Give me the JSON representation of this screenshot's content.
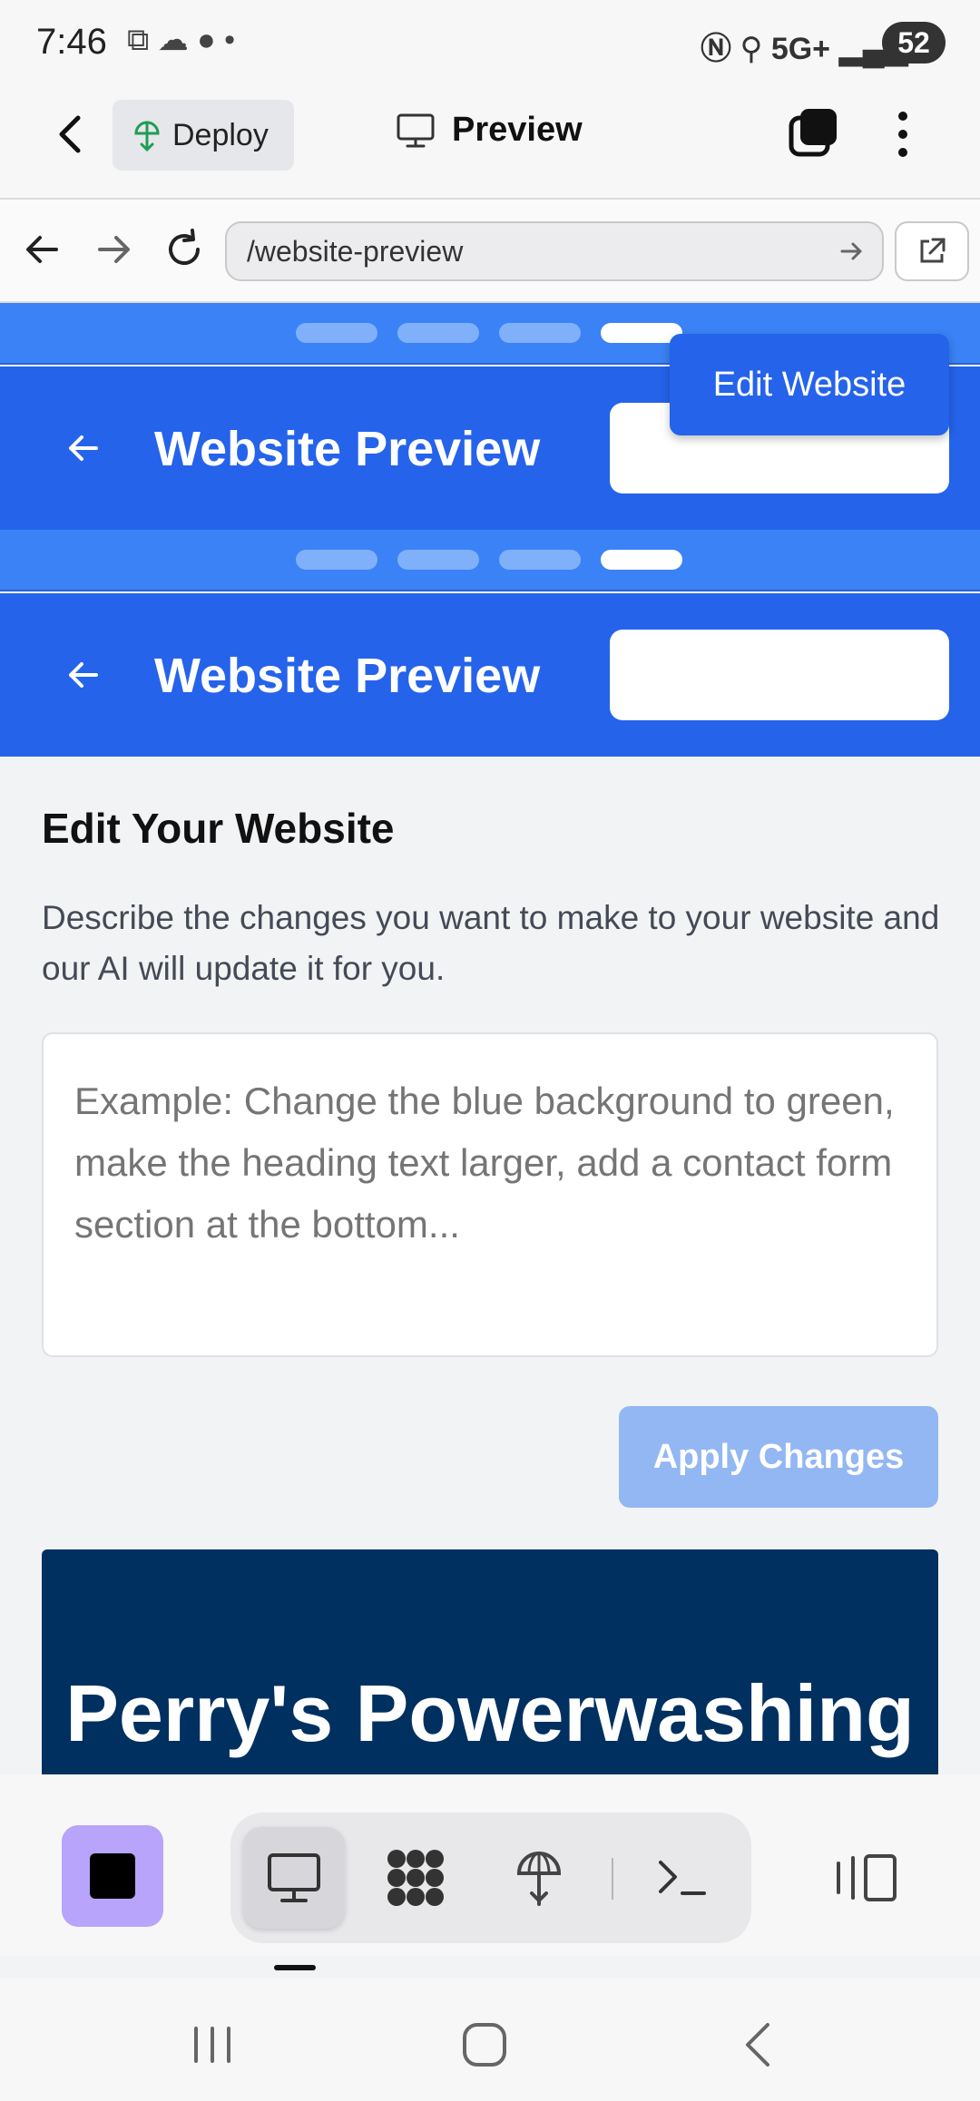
{
  "status_bar": {
    "time": "7:46",
    "network": "5G+",
    "battery": "52"
  },
  "app_bar": {
    "deploy_label": "Deploy",
    "preview_label": "Preview"
  },
  "url_bar": {
    "url": "/website-preview"
  },
  "website_preview": {
    "header_title": "Website Preview",
    "edit_button": "Edit Website",
    "carousel_pages": 4,
    "active_page": 4
  },
  "edit_panel": {
    "title": "Edit Your Website",
    "description": "Describe the changes you want to make to your website and our AI will update it for you.",
    "placeholder": "Example: Change the blue background to green, make the heading text larger, add a contact form section at the bottom...",
    "value": "",
    "apply_label": "Apply Changes"
  },
  "site_hero": {
    "title": "Perry's Powerwashing"
  },
  "colors": {
    "primary_blue": "#2563eb",
    "stripe_blue": "#3b82f6",
    "hero_navy": "#003060",
    "apply_disabled": "#93b7f3",
    "stop_purple": "#b8a4fb"
  },
  "icons": [
    "back-arrow-icon",
    "deploy-icon",
    "monitor-icon",
    "layers-icon",
    "more-vertical-icon",
    "arrow-left-icon",
    "arrow-right-icon",
    "reload-icon",
    "url-go-icon",
    "external-link-icon",
    "stop-icon",
    "grid-icon",
    "terminal-icon",
    "panel-icon",
    "recents-icon",
    "home-icon",
    "back-icon"
  ]
}
